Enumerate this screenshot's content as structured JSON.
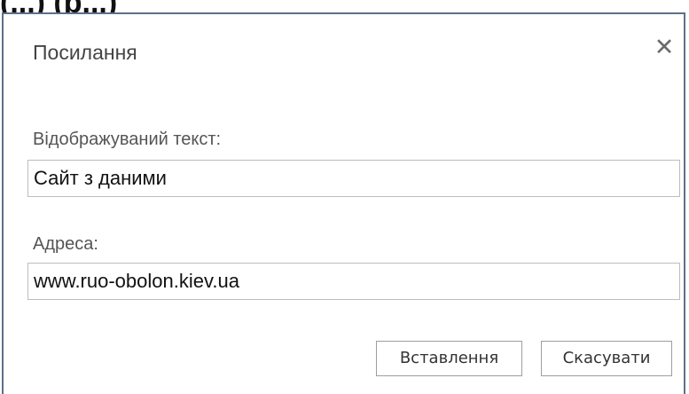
{
  "top_partial_text": "(...) (p...)",
  "dialog": {
    "title": "Посилання",
    "close_glyph": "✕",
    "display_text": {
      "label": "Відображуваний текст:",
      "value": "Сайт з  даними"
    },
    "address": {
      "label": "Адреса:",
      "value": "www.ruo-obolon.kiev.ua"
    },
    "buttons": {
      "insert": "Вставлення",
      "cancel": "Скасувати"
    }
  },
  "icons": {
    "close": "close-icon"
  },
  "colors": {
    "border": "#5f6f86",
    "input_border": "#bdbdbd",
    "button_border": "#9e9e9e"
  }
}
